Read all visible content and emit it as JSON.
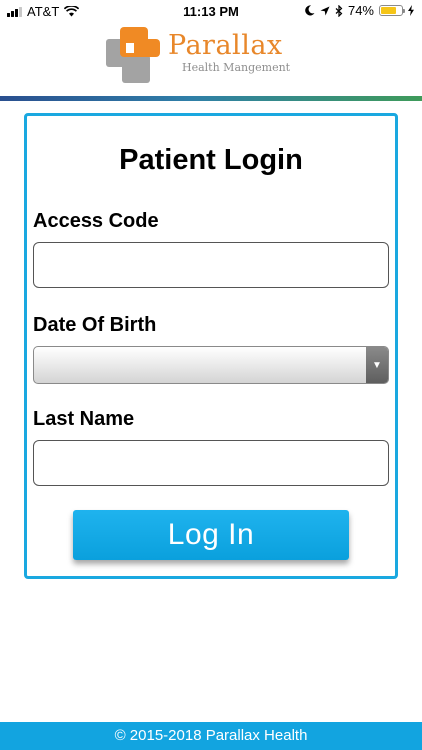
{
  "status_bar": {
    "carrier": "AT&T",
    "time": "11:13 PM",
    "battery_percent": "74%",
    "battery_level": 0.74,
    "battery_color": "#f5c518",
    "icons": [
      "signal-icon",
      "wifi-icon",
      "moon-icon",
      "location-icon",
      "bluetooth-icon",
      "battery-icon",
      "charging-icon"
    ]
  },
  "header": {
    "brand_name": "Parallax",
    "brand_tagline": "Health Mangement",
    "brand_orange": "#e8872a",
    "brand_gray": "#9a9a9a"
  },
  "login": {
    "title": "Patient Login",
    "access_code_label": "Access Code",
    "access_code_value": "",
    "dob_label": "Date Of Birth",
    "dob_value": "",
    "last_name_label": "Last Name",
    "last_name_value": "",
    "submit_label": "Log In",
    "accent_color": "#1aa8e0"
  },
  "footer": {
    "copyright": "© 2015-2018 Parallax Health",
    "background_color": "#12a4e0"
  }
}
